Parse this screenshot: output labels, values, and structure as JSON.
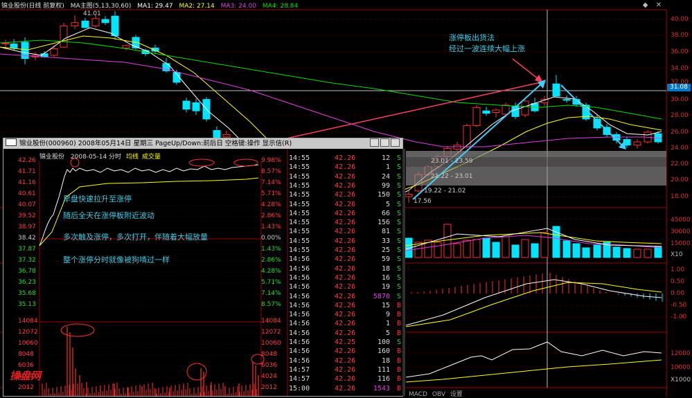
{
  "header": {
    "title": "锦业股份(日线 前复权)",
    "indicator": "MA主图(5,13,30,60)",
    "ma1": "MA1: 29.47",
    "ma2": "MA2: 27.14",
    "ma3": "MA3: 24.00",
    "ma4": "MA4: 28.84"
  },
  "main_axis": {
    "labels": [
      "40.00",
      "38.00",
      "36.00",
      "34.00",
      "32.00",
      "30.00",
      "28.00",
      "26.00",
      "24.00",
      "22.00",
      "20.00",
      "18.00"
    ],
    "current_price": "31.08",
    "high_mark": "41.01",
    "low_mark": "17.56",
    "range_labels": [
      "23.01 - 23.59",
      "21.22 - 23.01",
      "19.22 - 21.02"
    ]
  },
  "volume_axis": {
    "labels": [
      "45000",
      "30000",
      "15000",
      "X10"
    ]
  },
  "macd_axis": {
    "labels": [
      "1.00",
      "0.50",
      "0.00",
      "-0.50",
      "-1.00"
    ]
  },
  "obv_axis": {
    "labels": [
      "12000",
      "10000",
      "X1000"
    ]
  },
  "annotation_main": {
    "line1": "涨停板出货法",
    "line2": "经过一波连续大幅上涨"
  },
  "popup": {
    "title": "锦业股份(000960) 2008年05月14日 星期三 PageUp/Down:前后日 空格键:操作 显示信(R)",
    "chart_header": {
      "name": "锦业股份",
      "date": "2008-05-14 分时",
      "avg": "均线",
      "vol": "成交量"
    },
    "left_axis": [
      "42.26",
      "41.71",
      "41.16",
      "40.61",
      "40.07",
      "39.52",
      "38.97",
      "38.42",
      "37.87",
      "37.32",
      "36.78",
      "36.23",
      "35.68",
      "35.13",
      "14084",
      "12072",
      "10060",
      "8048",
      "6036",
      "4024",
      "2012"
    ],
    "right_axis": [
      "9.98%",
      "8.57%",
      "7.14%",
      "5.71%",
      "4.28%",
      "2.86%",
      "1.43%",
      "0.00%",
      "1.43%",
      "2.86%",
      "4.28%",
      "5.71%",
      "7.14%",
      "8.57%",
      "14084",
      "12072",
      "10060",
      "8048",
      "6036",
      "4024",
      "2012"
    ],
    "notes": [
      "早盘快速拉升至涨停",
      "随后全天在涨停板附近波动",
      "多次触及涨停，多次打开，伴随着大幅放量",
      "整个涨停分时就像被狗啃过一样"
    ],
    "ticks": [
      {
        "t": "14:55",
        "p": "42.26",
        "v": "12",
        "d": "S"
      },
      {
        "t": "14:55",
        "p": "42.26",
        "v": "1",
        "d": "S"
      },
      {
        "t": "14:55",
        "p": "42.26",
        "v": "24",
        "d": "S"
      },
      {
        "t": "14:55",
        "p": "42.26",
        "v": "99",
        "d": "S"
      },
      {
        "t": "14:55",
        "p": "42.26",
        "v": "150",
        "d": "S"
      },
      {
        "t": "14:55",
        "p": "42.26",
        "v": "5",
        "d": "S"
      },
      {
        "t": "14:55",
        "p": "42.26",
        "v": "66",
        "d": "S"
      },
      {
        "t": "14:55",
        "p": "42.26",
        "v": "156",
        "d": "S"
      },
      {
        "t": "14:55",
        "p": "42.26",
        "v": "81",
        "d": "S"
      },
      {
        "t": "14:55",
        "p": "42.26",
        "v": "33",
        "d": "S"
      },
      {
        "t": "14:55",
        "p": "42.26",
        "v": "25",
        "d": "S"
      },
      {
        "t": "14:56",
        "p": "42.26",
        "v": "59",
        "d": "S"
      },
      {
        "t": "14:56",
        "p": "42.26",
        "v": "18",
        "d": "S"
      },
      {
        "t": "14:56",
        "p": "42.26",
        "v": "16",
        "d": "S"
      },
      {
        "t": "14:56",
        "p": "42.26",
        "v": "19",
        "d": "S"
      },
      {
        "t": "14:56",
        "p": "42.26",
        "v": "5870",
        "d": "S"
      },
      {
        "t": "14:56",
        "p": "42.26",
        "v": "15",
        "d": "B"
      },
      {
        "t": "14:56",
        "p": "42.26",
        "v": "9",
        "d": "B"
      },
      {
        "t": "14:56",
        "p": "42.26",
        "v": "1",
        "d": "B"
      },
      {
        "t": "14:56",
        "p": "42.26",
        "v": "5",
        "d": "B"
      },
      {
        "t": "14:56",
        "p": "42.25",
        "v": "100",
        "d": "S"
      },
      {
        "t": "14:56",
        "p": "42.26",
        "v": "160",
        "d": "B"
      },
      {
        "t": "14:56",
        "p": "42.26",
        "v": "18",
        "d": "B"
      },
      {
        "t": "14:57",
        "p": "42.26",
        "v": "111",
        "d": "B"
      },
      {
        "t": "14:57",
        "p": "42.26",
        "v": "116",
        "d": "B"
      },
      {
        "t": "15:00",
        "p": "42.26",
        "v": "1543",
        "d": "B"
      }
    ]
  },
  "watermark": "操盘网",
  "bottom_tabs": [
    "MACD",
    "OBV",
    "设置"
  ],
  "colors": {
    "up": "#ff3030",
    "down": "#00e5ff",
    "ma5": "#ffffff",
    "ma13": "#ffff00",
    "ma30": "#00e000",
    "ma60": "#e040e0",
    "annotation": "#3fd0e8"
  }
}
